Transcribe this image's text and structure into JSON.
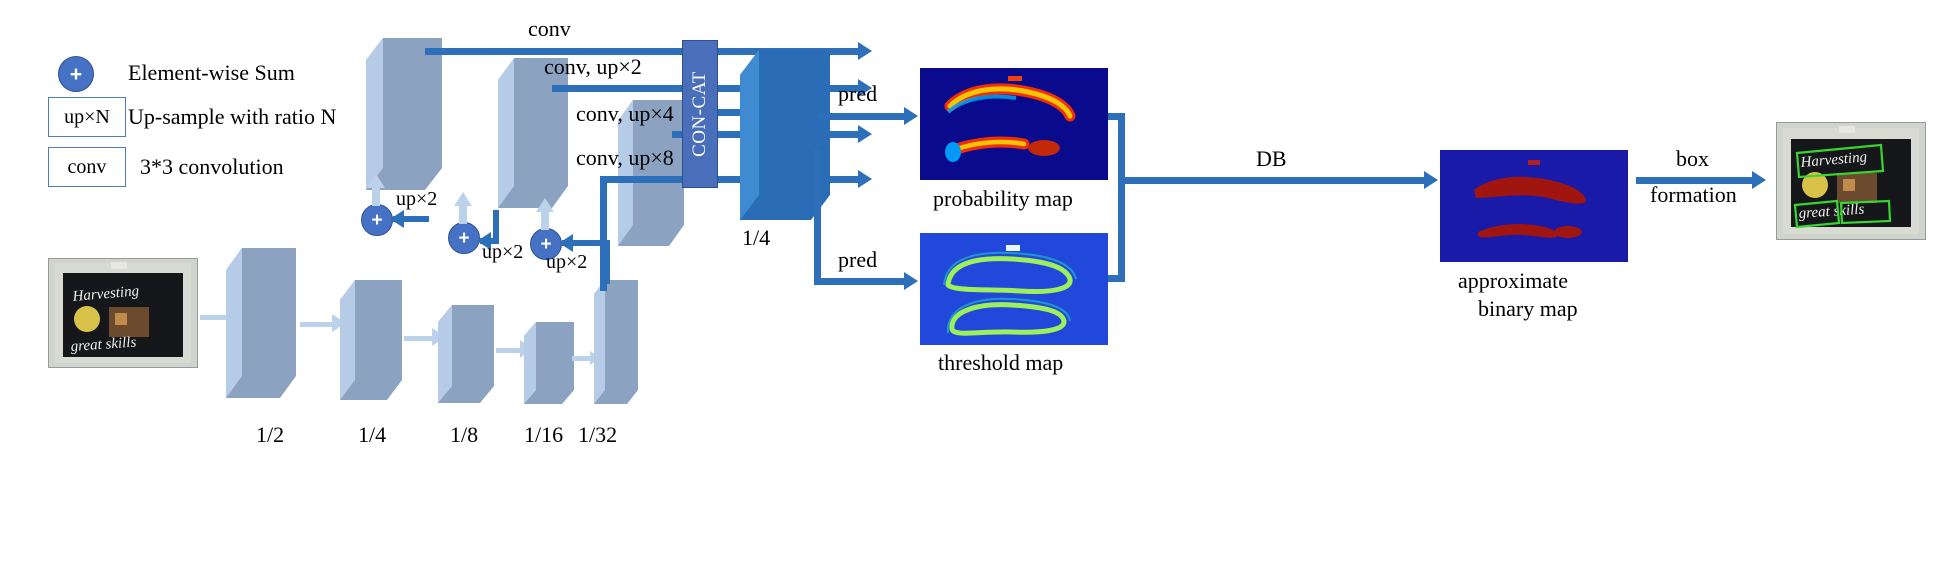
{
  "diagram": {
    "title": "DB text detection network architecture",
    "colors": {
      "arrow_blue": "#2e6fba",
      "arrow_light": "#bcd2ea",
      "slab_fill": "#8ba2c0",
      "slab_edge": "#b6cbe6",
      "concat_fill": "#4a6fba",
      "sum_fill": "#4572c4",
      "output_slab": "#2a6cb5"
    }
  },
  "legend": {
    "items": [
      {
        "symbol": "+",
        "icon": "plus-circle-icon",
        "label": "Element-wise Sum"
      },
      {
        "symbol": "up×N",
        "icon": "upsample-box-icon",
        "label": "Up-sample with ratio N"
      },
      {
        "symbol": "conv",
        "icon": "conv-box-icon",
        "label": "3*3 convolution"
      }
    ]
  },
  "backbone": {
    "scale_labels": [
      "1/2",
      "1/4",
      "1/8",
      "1/16",
      "1/32"
    ]
  },
  "fpn": {
    "lateral_labels": [
      "conv",
      "conv, up×2",
      "conv, up×4",
      "conv, up×8"
    ],
    "upsample_labels": [
      "up×2",
      "up×2",
      "up×2"
    ],
    "concat_label": "CON-CAT",
    "fused_scale_label": "1/4"
  },
  "heads": {
    "pred_labels": [
      "pred",
      "pred"
    ],
    "probability_map_label": "probability map",
    "threshold_map_label": "threshold map",
    "db_label": "DB",
    "approximate_binary_map_label": "approximate\nbinary map",
    "approximate_binary_map_line1": "approximate",
    "approximate_binary_map_line2": "binary map",
    "box_formation_line1": "box",
    "box_formation_line2": "formation"
  },
  "input_image": {
    "alt": "scene text photo of a blackboard reading Harvesting great skills"
  },
  "output_image": {
    "alt": "same photo with detected text boxes drawn around Harvesting great skills"
  }
}
